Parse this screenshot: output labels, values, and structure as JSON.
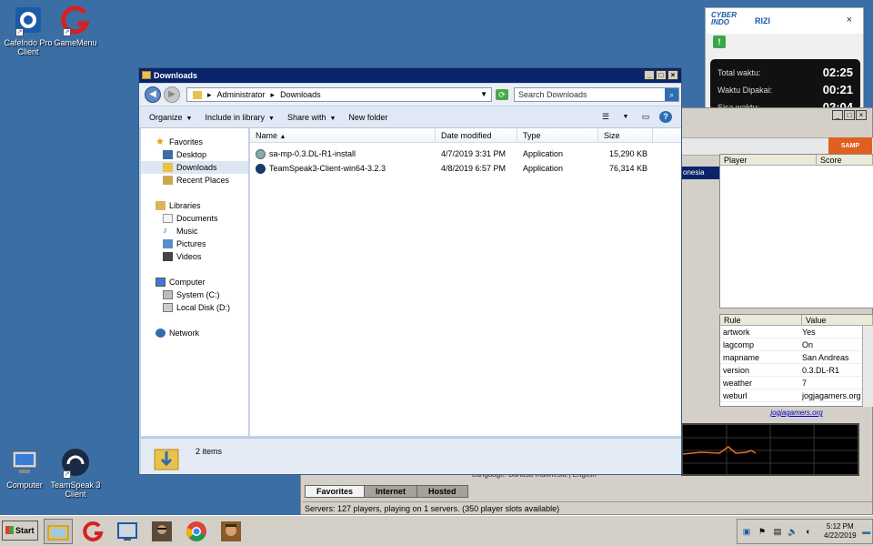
{
  "desktop": {
    "icons": [
      {
        "label": "CafeIndo Pro Client"
      },
      {
        "label": "GameMenu"
      },
      {
        "label": "Computer"
      },
      {
        "label": "TeamSpeak 3 Client"
      }
    ]
  },
  "cyber_widget": {
    "logo_line1": "CYBER",
    "logo_line2": "INDO",
    "user": "RIZI",
    "close": "×",
    "rows": [
      {
        "label": "Total waktu:",
        "value": "02:25"
      },
      {
        "label": "Waktu Dipakai:",
        "value": "00:21"
      },
      {
        "label": "Sisa waktu:",
        "value": "02:04"
      }
    ]
  },
  "samp": {
    "logo": "SAMP",
    "list_strip": "onesia",
    "player_header": {
      "player": "Player",
      "score": "Score"
    },
    "rules_header": {
      "rule": "Rule",
      "value": "Value"
    },
    "rules": [
      {
        "rule": "artwork",
        "value": "Yes"
      },
      {
        "rule": "lagcomp",
        "value": "On"
      },
      {
        "rule": "mapname",
        "value": "San Andreas"
      },
      {
        "rule": "version",
        "value": "0.3.DL-R1"
      },
      {
        "rule": "weather",
        "value": "7"
      },
      {
        "rule": "weburl",
        "value": "jogjagamers.org"
      }
    ],
    "link": "jogjagamers.org",
    "info_line": "Language:  Bahasa Indonesia | English",
    "tabs": [
      "Favorites",
      "Internet",
      "Hosted"
    ],
    "status": "Servers: 127 players, playing on 1 servers. (350 player slots available)"
  },
  "explorer": {
    "title": "Downloads",
    "breadcrumb": [
      "Administrator",
      "Downloads"
    ],
    "search_placeholder": "Search Downloads",
    "toolbar": {
      "organize": "Organize",
      "include": "Include in library",
      "share": "Share with",
      "new_folder": "New folder"
    },
    "nav": {
      "favorites": "Favorites",
      "desktop": "Desktop",
      "downloads": "Downloads",
      "recent": "Recent Places",
      "libraries": "Libraries",
      "documents": "Documents",
      "music": "Music",
      "pictures": "Pictures",
      "videos": "Videos",
      "computer": "Computer",
      "system": "System (C:)",
      "local": "Local Disk (D:)",
      "network": "Network"
    },
    "columns": {
      "name": "Name",
      "date": "Date modified",
      "type": "Type",
      "size": "Size"
    },
    "files": [
      {
        "name": "sa-mp-0.3.DL-R1-install",
        "date": "4/7/2019 3:31 PM",
        "type": "Application",
        "size": "15,290 KB"
      },
      {
        "name": "TeamSpeak3-Client-win64-3.2.3",
        "date": "4/8/2019 6:57 PM",
        "type": "Application",
        "size": "76,314 KB"
      }
    ],
    "item_count": "2 items"
  },
  "taskbar": {
    "start": "Start",
    "time": "5:12 PM",
    "date": "4/22/2019"
  }
}
